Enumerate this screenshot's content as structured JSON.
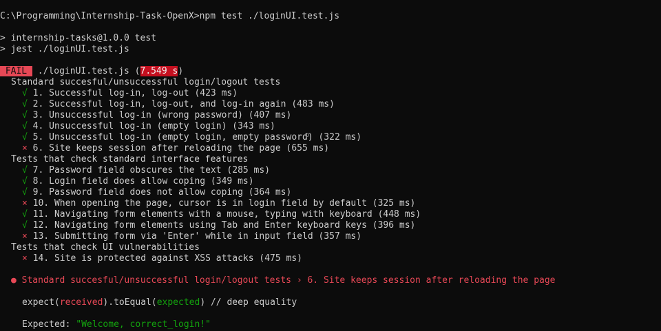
{
  "prompt_line": "C:\\Programming\\Internship-Task-OpenX>npm test ./loginUI.test.js",
  "npm_header": {
    "line1": "> internship-tasks@1.0.0 test",
    "line2": "> jest ./loginUI.test.js"
  },
  "result": {
    "badge": " FAIL ",
    "file": " ./loginUI.test.js (",
    "time": "7.549 s",
    "close": ")"
  },
  "suites": [
    {
      "title": "Standard succesful/unsuccessful login/logout tests",
      "tests": [
        {
          "mark": "√",
          "text": "1. Successful log-in, log-out (423 ms)"
        },
        {
          "mark": "√",
          "text": "2. Successful log-in, log-out, and log-in again (483 ms)"
        },
        {
          "mark": "√",
          "text": "3. Unsuccessful log-in (wrong password) (407 ms)"
        },
        {
          "mark": "√",
          "text": "4. Unsuccessful log-in (empty login) (343 ms)"
        },
        {
          "mark": "√",
          "text": "5. Unsuccessful log-in (empty login, empty password) (322 ms)"
        },
        {
          "mark": "×",
          "text": "6. Site keeps session after reloading the page (655 ms)"
        }
      ]
    },
    {
      "title": "Tests that check standard interface features",
      "tests": [
        {
          "mark": "√",
          "text": "7. Password field obscures the text (285 ms)"
        },
        {
          "mark": "√",
          "text": "8. Login field does allow coping (349 ms)"
        },
        {
          "mark": "√",
          "text": "9. Password field does not allow coping (364 ms)"
        },
        {
          "mark": "×",
          "text": "10. When opening the page, cursor is in login field by default (325 ms)"
        },
        {
          "mark": "√",
          "text": "11. Navigating form elements with a mouse, typing with keyboard (448 ms)"
        },
        {
          "mark": "√",
          "text": "12. Navigating form elements using Tab and Enter keyboard keys (396 ms)"
        },
        {
          "mark": "×",
          "text": "13. Submitting form via 'Enter' while in input field (357 ms)"
        }
      ]
    },
    {
      "title": "Tests that check UI vulnerabilities",
      "tests": [
        {
          "mark": "×",
          "text": "14. Site is protected against XSS attacks (475 ms)"
        }
      ]
    }
  ],
  "error": {
    "bullet": "●",
    "heading": "Standard succesful/unsuccessful login/logout tests › 6. Site keeps session after reloading the page"
  },
  "expect_line": {
    "p1": "expect(",
    "received": "received",
    "p2": ").toEqual(",
    "expected": "expected",
    "p3": ") // deep equality"
  },
  "expected_value": {
    "label": "Expected: ",
    "value": "\"Welcome, correct_login!\""
  },
  "colors": {
    "background": "#0c0c0c",
    "text": "#cccccc",
    "pass": "#13a10e",
    "fail": "#e74856",
    "time_highlight": "#c50f1f"
  }
}
